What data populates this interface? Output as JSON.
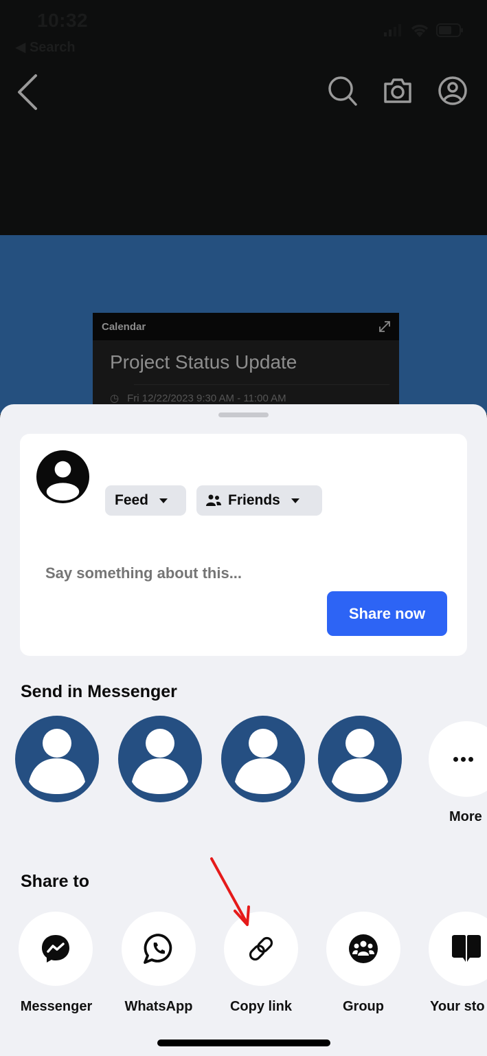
{
  "status_bar": {
    "time": "10:32",
    "back_label": "◀ Search"
  },
  "nav": {
    "back_icon": "chevron-left-icon",
    "icons": [
      "search-icon",
      "camera-icon",
      "profile-icon"
    ]
  },
  "background_post": {
    "card_header": "Calendar",
    "event_title": "Project Status Update",
    "event_time_partial": "Fri 12/22/2023 9:30 AM - 11:00 AM"
  },
  "composer": {
    "audience_feed_label": "Feed",
    "audience_privacy_label": "Friends",
    "input_placeholder": "Say something about this...",
    "input_value": "",
    "share_button_label": "Share now"
  },
  "messenger_section": {
    "title": "Send in Messenger",
    "contacts_count": 4,
    "more_label": "More"
  },
  "share_to_section": {
    "title": "Share to",
    "targets": [
      {
        "label": "Messenger",
        "icon": "messenger-icon"
      },
      {
        "label": "WhatsApp",
        "icon": "whatsapp-icon"
      },
      {
        "label": "Copy link",
        "icon": "link-icon"
      },
      {
        "label": "Group",
        "icon": "group-icon"
      },
      {
        "label": "Your sto",
        "icon": "story-icon"
      }
    ]
  },
  "annotation": {
    "type": "red-arrow",
    "points_to": "Copy link",
    "color": "#e51a1a"
  },
  "colors": {
    "accent": "#2d64f5",
    "contact_avatar": "#254f82",
    "sheet_bg": "#f0f1f5"
  }
}
